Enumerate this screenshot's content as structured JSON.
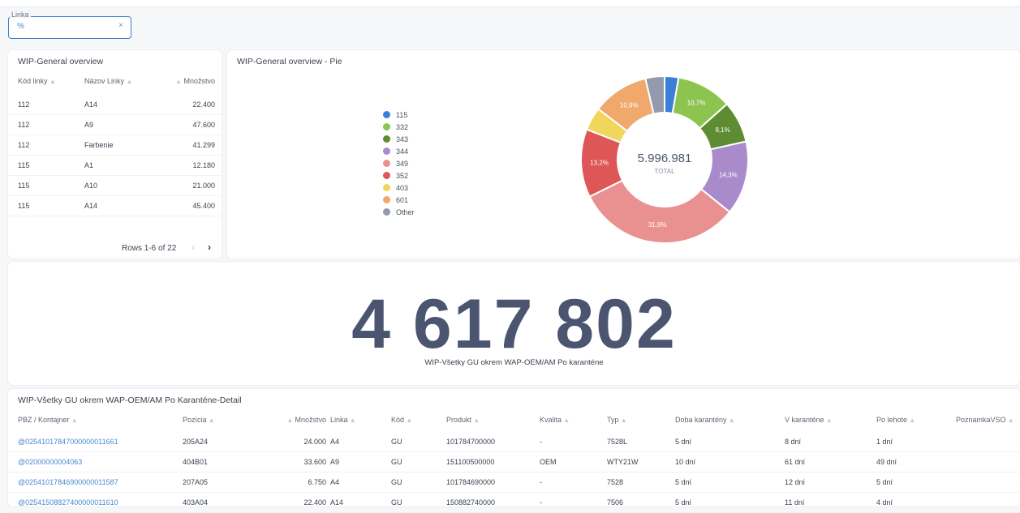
{
  "filter": {
    "label": "Linka",
    "value": "%",
    "clear_icon": "×"
  },
  "overview": {
    "title": "WIP-General overview",
    "columns": [
      "Kód linky",
      "Názov Linky",
      "Množstvo"
    ],
    "rows": [
      [
        "112",
        "A14",
        "22.400"
      ],
      [
        "112",
        "A9",
        "47.600"
      ],
      [
        "112",
        "Farbenie",
        "41.299"
      ],
      [
        "115",
        "A1",
        "12.180"
      ],
      [
        "115",
        "A10",
        "21.000"
      ],
      [
        "115",
        "A14",
        "45.400"
      ]
    ],
    "pager": "Rows 1-6 of 22",
    "prev_icon": "‹",
    "next_icon": "›"
  },
  "pie": {
    "title": "WIP-General overview - Pie",
    "total": "5.996.981",
    "total_label": "TOTAL",
    "legend": [
      {
        "name": "115",
        "color": "#3c7fd8"
      },
      {
        "name": "332",
        "color": "#8cc44f"
      },
      {
        "name": "343",
        "color": "#5e8c32"
      },
      {
        "name": "344",
        "color": "#a98bcb"
      },
      {
        "name": "349",
        "color": "#e99190"
      },
      {
        "name": "352",
        "color": "#de5656"
      },
      {
        "name": "403",
        "color": "#f0d65a"
      },
      {
        "name": "601",
        "color": "#f0a86d"
      },
      {
        "name": "Other",
        "color": "#939aab"
      }
    ]
  },
  "chart_data": {
    "type": "pie",
    "title": "WIP-General overview - Pie",
    "categories": [
      "115",
      "332",
      "343",
      "344",
      "349",
      "352",
      "403",
      "601",
      "Other"
    ],
    "values": [
      2.7,
      10.7,
      8.1,
      14.3,
      31.9,
      13.2,
      4.5,
      10.9,
      3.7
    ],
    "labels": [
      "",
      "10,7%",
      "8,1%",
      "14,3%",
      "31,9%",
      "13,2%",
      "",
      "10,9%",
      ""
    ],
    "total": "5.996.981"
  },
  "big": {
    "value": "4 617 802",
    "label": "WIP-Všetky GU okrem WAP-OEM/AM Po karanténe"
  },
  "detail": {
    "title": "WIP-Všetky GU okrem WAP-OEM/AM Po Karanténe-Detail",
    "columns": [
      "PBZ / Kontajner",
      "Pozícia",
      "Množstvo",
      "Linka",
      "Kód",
      "Produkt",
      "Kvalita",
      "Typ",
      "Doba karantény",
      "V karanténe",
      "Po lehote",
      "PoznamkaVSO"
    ],
    "rows": [
      [
        "@02541017847000000011661",
        "205A24",
        "24.000",
        "A4",
        "GU",
        "101784700000",
        "-",
        "7528L",
        "5 dní",
        "8 dní",
        "1 dní",
        ""
      ],
      [
        "@02000000004063",
        "404B01",
        "33.600",
        "A9",
        "GU",
        "151100500000",
        "OEM",
        "WTY21W",
        "10 dní",
        "61 dní",
        "49 dní",
        ""
      ],
      [
        "@02541017846900000011587",
        "207A05",
        "6.750",
        "A4",
        "GU",
        "101784690000",
        "-",
        "7528",
        "5 dní",
        "12 dní",
        "5 dní",
        ""
      ],
      [
        "@02541508827400000011610",
        "403A04",
        "22.400",
        "A14",
        "GU",
        "150882740000",
        "-",
        "7506",
        "5 dní",
        "11 dní",
        "4 dní",
        ""
      ]
    ]
  }
}
